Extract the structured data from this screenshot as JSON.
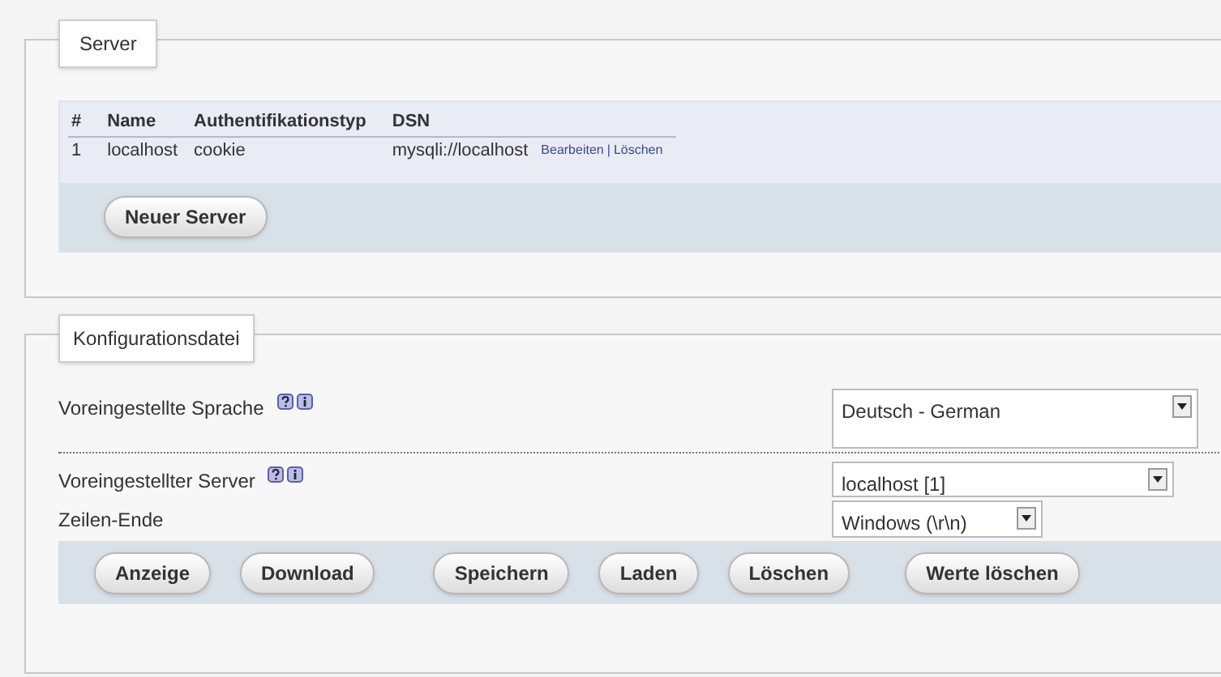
{
  "server_section": {
    "legend": "Server",
    "table": {
      "columns": [
        "#",
        "Name",
        "Authentifikationstyp",
        "DSN"
      ],
      "rows": [
        {
          "cells": [
            "1",
            "localhost",
            "cookie",
            "mysqli://localhost"
          ],
          "actions": [
            "Bearbeiten",
            "|",
            "Löschen"
          ]
        }
      ]
    },
    "button": "Neuer Server"
  },
  "config_section": {
    "legend": "Konfigurationsdatei",
    "fields": [
      {
        "kind": "tall",
        "label": "Voreingestellte Sprache",
        "value": "Deutsch - German"
      },
      {
        "kind": "medium",
        "label": "Voreingestellter Server",
        "value": "localhost [1]"
      },
      {
        "kind": "narrow",
        "label": "Zeilen-Ende",
        "value": "Windows (\\r\\n)"
      }
    ],
    "buttons": [
      "Anzeige",
      "Download",
      "Speichern",
      "Laden",
      "Löschen",
      "Werte löschen"
    ]
  }
}
